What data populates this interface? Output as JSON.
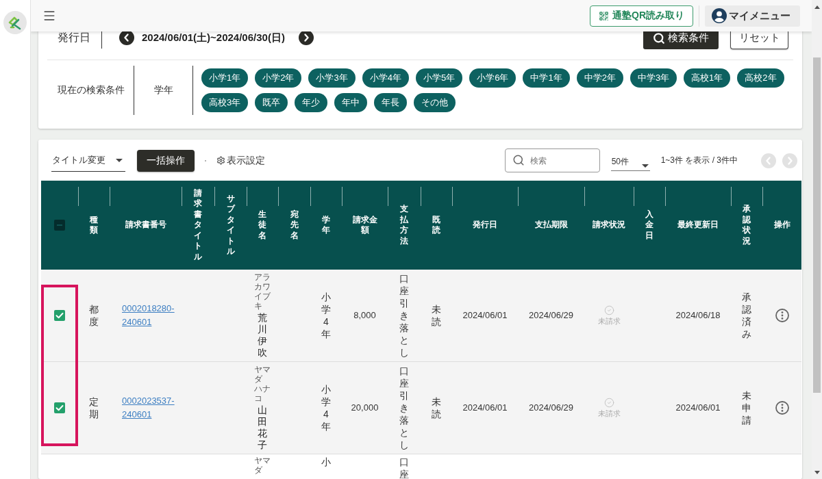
{
  "header": {
    "qr_button": "通塾QR読み取り",
    "menu_button": "マイメニュー"
  },
  "search_panel": {
    "date_label": "発行日",
    "date_range": "2024/06/01(土)~2024/06/30(日)",
    "search_button": "検索条件",
    "reset_button": "リセット",
    "conditions_label": "現在の検索条件",
    "conditions": [
      {
        "name": "学年",
        "values": [
          "小学1年",
          "小学2年",
          "小学3年",
          "小学4年",
          "小学5年",
          "小学6年",
          "中学1年",
          "中学2年",
          "中学3年",
          "高校1年",
          "高校2年",
          "高校3年",
          "既卒",
          "年少",
          "年中",
          "年長",
          "その他"
        ]
      }
    ]
  },
  "toolbar": {
    "title_select": "タイトル変更",
    "bulk_button": "一括操作",
    "display_settings": "表示設定",
    "search": {
      "placeholder": "検索"
    },
    "page_size": "50件",
    "range_info": "1~3件 を表示 / 3件中",
    "prev_page": {
      "disabled": true
    },
    "next_page": {
      "disabled": true
    }
  },
  "table": {
    "select_all": {
      "indeterminate": true
    },
    "columns": [
      "種類",
      "請求書番号",
      "請求書タイトル",
      "サブタイトル",
      "生徒名",
      "宛先名",
      "学年",
      "請求金額",
      "支払方法",
      "既読",
      "発行日",
      "支払期限",
      "請求状況",
      "入金日",
      "最終更新日",
      "承認状況",
      "操作"
    ],
    "rows": [
      {
        "selected": true,
        "cut_off": false,
        "type": "都度",
        "invoice_number": "0002018280-240601",
        "furigana_family": "アラカワ",
        "furigana_given": "イブキ",
        "student_name": "荒川伊吹",
        "grade": "小学4年",
        "amount": "8,000",
        "payment_method": "口座引き落とし",
        "read_status": "未読",
        "issue_date": "2024/06/01",
        "due_date": "2024/06/29",
        "billing_status": "未請求",
        "last_updated": "2024/06/18",
        "approval_status": "承認済み"
      },
      {
        "selected": true,
        "cut_off": false,
        "type": "定期",
        "invoice_number": "0002023537-240601",
        "furigana_family": "ヤマダ",
        "furigana_given": "ハナコ",
        "student_name": "山田花子",
        "grade": "小学4年",
        "amount": "20,000",
        "payment_method": "口座引き落とし",
        "read_status": "未読",
        "issue_date": "2024/06/01",
        "due_date": "2024/06/29",
        "billing_status": "未請求",
        "last_updated": "2024/06/01",
        "approval_status": "未申請"
      },
      {
        "cut_off": true,
        "furigana_family": "ヤマダ",
        "grade": "小",
        "payment_method": "口座"
      }
    ]
  }
}
